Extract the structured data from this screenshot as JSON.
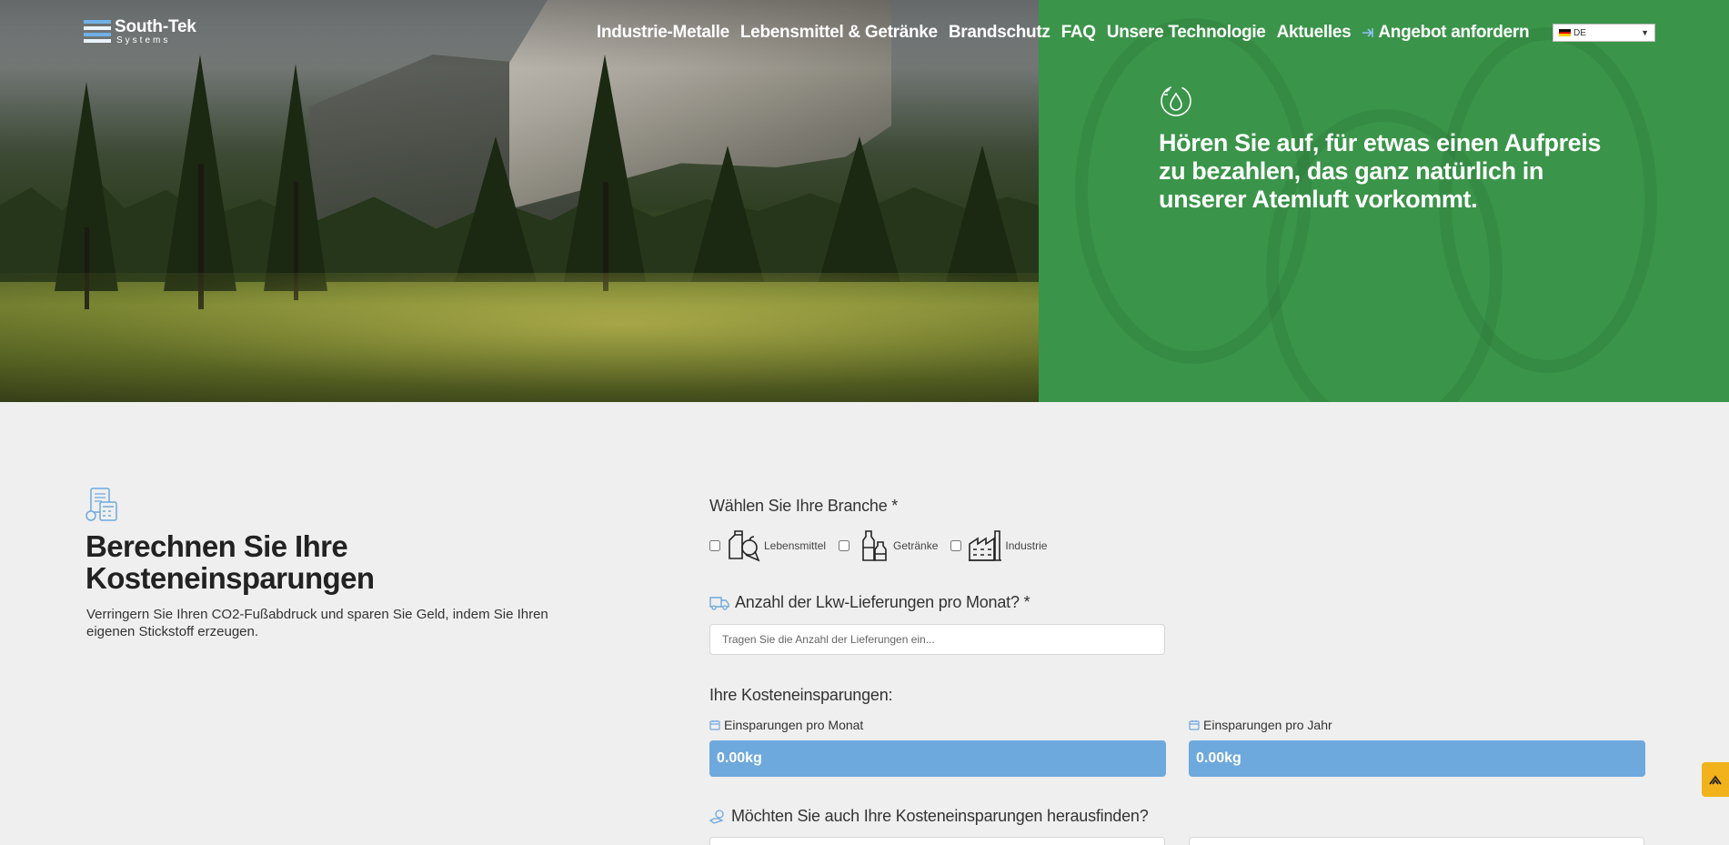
{
  "header": {
    "logo_name": "South-Tek",
    "logo_sub": "Systems",
    "nav": [
      "Industrie-Metalle",
      "Lebensmittel & Getränke",
      "Brandschutz",
      "FAQ",
      "Unsere Technologie",
      "Aktuelles"
    ],
    "quote_label": "Angebot anfordern",
    "language": "DE",
    "icons": {
      "quote": "login-arrow-icon",
      "flag": "german-flag-icon",
      "dropdown": "dropdown-arrow-icon"
    }
  },
  "hero": {
    "heading": "Hören Sie auf, für etwas einen Aufpreis zu bezahlen, das ganz natürlich in unserer Atemluft vorkommt.",
    "icon": "eco-water-icon",
    "panel_color": "#3a9449"
  },
  "calculator": {
    "title": "Berechnen Sie Ihre Kosteneinsparungen",
    "description": "Verringern Sie Ihren CO2-Fußabdruck und sparen Sie Geld, indem Sie Ihren eigenen Stickstoff erzeugen.",
    "icon": "calculator-icon"
  },
  "form": {
    "branche_label": "Wählen Sie Ihre Branche *",
    "branches": [
      {
        "label": "Lebensmittel",
        "icon": "food-icon",
        "checked": false
      },
      {
        "label": "Getränke",
        "icon": "bottles-icon",
        "checked": false
      },
      {
        "label": "Industrie",
        "icon": "factory-icon",
        "checked": false
      }
    ],
    "deliveries_label": "Anzahl der Lkw-Lieferungen pro Monat? *",
    "deliveries_placeholder": "Tragen Sie die Anzahl der Lieferungen ein...",
    "savings_heading": "Ihre Kosteneinsparungen:",
    "monthly_label": "Einsparungen pro Monat",
    "monthly_value": "0.00kg",
    "yearly_label": "Einsparungen pro Jahr",
    "yearly_value": "0.00kg",
    "cost_question": "Möchten Sie auch Ihre Kosteneinsparungen herausfinden?",
    "accent_color": "#6ea9dd"
  },
  "scroll_top": {
    "icon": "chevron-up-icon",
    "color": "#f2b21b"
  }
}
